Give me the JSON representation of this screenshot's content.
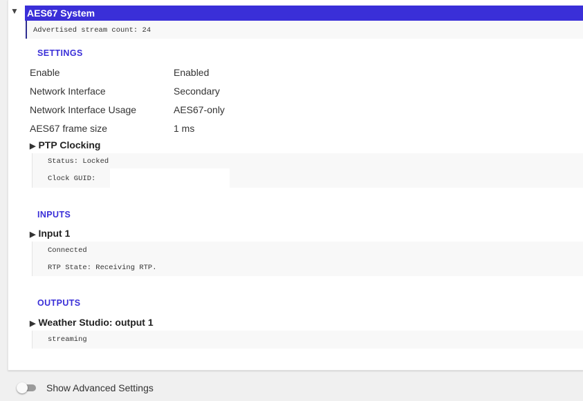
{
  "panel": {
    "title": "AES67 System",
    "collapse_icon": "triangle-down",
    "stream_count_text": "Advertised stream count: 24"
  },
  "settings": {
    "header": "SETTINGS",
    "rows": [
      {
        "label": "Enable",
        "value": "Enabled"
      },
      {
        "label": "Network Interface",
        "value": "Secondary"
      },
      {
        "label": "Network Interface Usage",
        "value": "AES67-only"
      },
      {
        "label": "AES67 frame size",
        "value": "1 ms"
      }
    ],
    "ptp": {
      "label": "PTP Clocking",
      "status": "Status: Locked",
      "clock_guid": "Clock GUID:"
    }
  },
  "inputs": {
    "header": "INPUTS",
    "items": [
      {
        "label": "Input 1",
        "status": "Connected",
        "rtp_state": "RTP State: Receiving RTP."
      }
    ]
  },
  "outputs": {
    "header": "OUTPUTS",
    "items": [
      {
        "label": "Weather Studio: output 1",
        "status": "streaming"
      }
    ]
  },
  "advanced": {
    "label": "Show Advanced Settings",
    "enabled": false
  },
  "colors": {
    "accent": "#3a2fd8",
    "title_text": "#ffffff",
    "page_bg": "#f0f0f0",
    "detail_bg": "#f8f8f8"
  }
}
